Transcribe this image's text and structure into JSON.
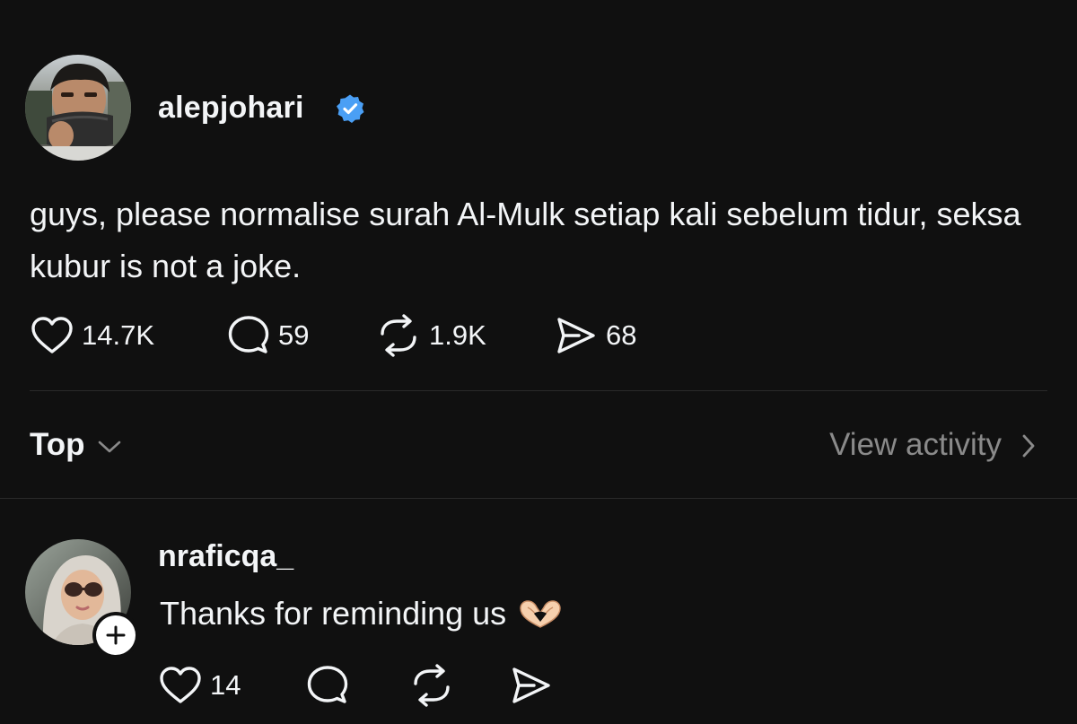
{
  "post": {
    "username": "alepjohari",
    "verified": true,
    "verified_icon": "verified-badge-icon",
    "text": "guys, please normalise surah Al-Mulk setiap kali sebelum tidur, seksa kubur is not a joke.",
    "actions": {
      "likes": "14.7K",
      "comments": "59",
      "reposts": "1.9K",
      "shares": "68"
    }
  },
  "replies_header": {
    "sort_label": "Top",
    "view_activity_label": "View activity"
  },
  "reply": {
    "username": "nraficqa_",
    "text": "Thanks for reminding us",
    "emoji_icon": "heart-hands-icon",
    "actions": {
      "likes": "14"
    }
  },
  "colors": {
    "background": "#101010",
    "text": "#f3f5f7",
    "secondary_text": "#8a8a8a",
    "verified_blue": "#4a9ff5",
    "divider": "#2a2a2a"
  }
}
